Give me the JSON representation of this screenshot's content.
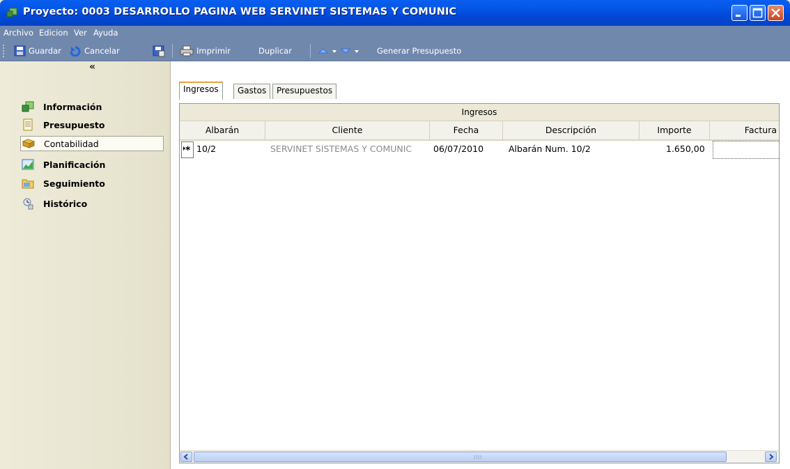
{
  "window": {
    "title": "Proyecto: 0003 DESARROLLO PAGINA WEB SERVINET SISTEMAS Y COMUNIC",
    "controls": [
      "minimize-icon",
      "maximize-icon",
      "close-icon"
    ]
  },
  "menu": {
    "archivo": "Archivo",
    "edicion": "Edicion",
    "ver": "Ver",
    "ayuda": "Ayuda"
  },
  "toolbar": {
    "guardar": "Guardar",
    "cancelar": "Cancelar",
    "imprimir": "Imprimir",
    "duplicar": "Duplicar",
    "generar": "Generar Presupuesto"
  },
  "sidebar": {
    "collapse": "«",
    "items": [
      {
        "label": "Información",
        "icon": "project-icon"
      },
      {
        "label": "Presupuesto",
        "icon": "document-icon"
      },
      {
        "label": "Contabilidad",
        "icon": "accounting-icon"
      },
      {
        "label": "Planificación",
        "icon": "chart-icon"
      },
      {
        "label": "Seguimiento",
        "icon": "folder-icon"
      },
      {
        "label": "Histórico",
        "icon": "history-icon"
      }
    ],
    "selected": "Contabilidad"
  },
  "tabs": [
    "Ingresos",
    "Gastos",
    "Presupuestos"
  ],
  "grid": {
    "band_title": "Ingresos",
    "columns": [
      "Albarán",
      "Cliente",
      "Fecha",
      "Descripción",
      "Importe",
      "Factura"
    ],
    "rows": [
      {
        "albaran": "10/2",
        "cliente": "SERVINET SISTEMAS Y COMUNIC",
        "fecha": "06/07/2010",
        "descripcion": "Albarán Num. 10/2",
        "importe": "1.650,00",
        "factura": ""
      }
    ]
  },
  "colors": {
    "titlebar": "#0458e8",
    "menubar": "#7188ad",
    "sidebar": "#eeecd9",
    "active_tab_accent": "#e8a23c"
  }
}
